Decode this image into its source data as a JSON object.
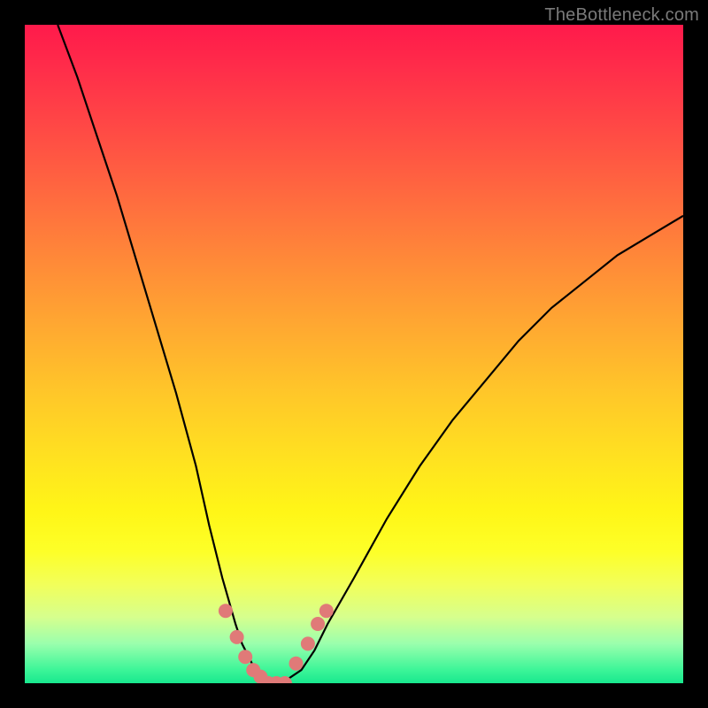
{
  "watermark": "TheBottleneck.com",
  "chart_data": {
    "type": "line",
    "title": "",
    "xlabel": "",
    "ylabel": "",
    "xlim": [
      0,
      100
    ],
    "ylim": [
      0,
      100
    ],
    "grid": false,
    "legend": false,
    "series": [
      {
        "name": "bottleneck-curve",
        "color": "#000000",
        "x": [
          5,
          8,
          11,
          14,
          17,
          20,
          23,
          26,
          28,
          30,
          32,
          33,
          34,
          35,
          36,
          37,
          38,
          39,
          42,
          44,
          46,
          50,
          55,
          60,
          65,
          70,
          75,
          80,
          85,
          90,
          95,
          100
        ],
        "y": [
          100,
          92,
          83,
          74,
          64,
          54,
          44,
          33,
          24,
          16,
          9,
          6,
          4,
          2,
          1,
          0,
          0,
          0,
          2,
          5,
          9,
          16,
          25,
          33,
          40,
          46,
          52,
          57,
          61,
          65,
          68,
          71
        ]
      }
    ],
    "markers": {
      "name": "highlighted-points",
      "color": "#e07a78",
      "x": [
        30.5,
        32.2,
        33.5,
        34.7,
        35.8,
        37.0,
        38.2,
        39.5,
        41.2,
        43.0,
        44.5,
        45.8
      ],
      "y": [
        11,
        7,
        4,
        2,
        1,
        0,
        0,
        0,
        3,
        6,
        9,
        11
      ]
    }
  },
  "colors": {
    "frame": "#000000",
    "curve": "#000000",
    "markers": "#e07a78",
    "gradient_top": "#ff1a4b",
    "gradient_bottom": "#18e88e"
  }
}
